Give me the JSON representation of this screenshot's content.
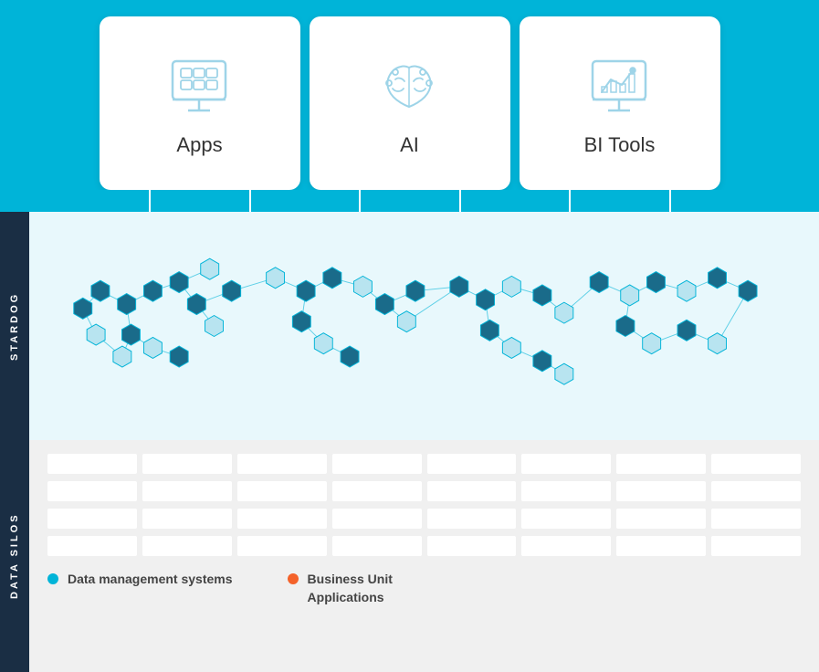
{
  "background_color": "#00b4d8",
  "top_cards": [
    {
      "id": "apps",
      "label": "Apps",
      "icon": "apps-icon"
    },
    {
      "id": "ai",
      "label": "AI",
      "icon": "ai-icon"
    },
    {
      "id": "bi-tools",
      "label": "BI Tools",
      "icon": "bi-tools-icon"
    }
  ],
  "stardog_label": "STARDOG",
  "data_silos_label": "DATA SILOS",
  "legend": [
    {
      "color": "blue",
      "text": "Data management systems",
      "dot_color": "#00b4d8"
    },
    {
      "color": "orange",
      "text": "Business Unit\nApplications",
      "dot_color": "#f4622a"
    }
  ],
  "silo_rows": 4,
  "silo_cols": 8
}
